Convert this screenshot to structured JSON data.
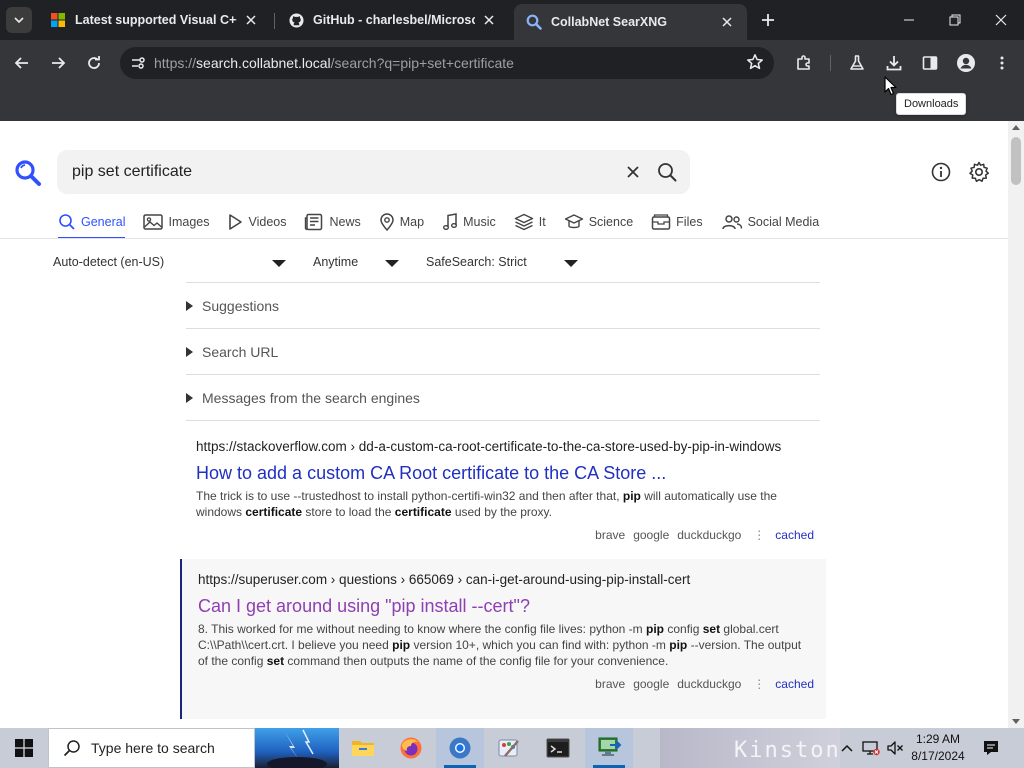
{
  "browser": {
    "tabs": [
      {
        "title": "Latest supported Visual C++ R",
        "favicon": "microsoft-logo",
        "active": false
      },
      {
        "title": "GitHub - charlesbel/Microsoft",
        "favicon": "github-icon",
        "active": false
      },
      {
        "title": "CollabNet SearXNG",
        "favicon": "search-icon",
        "active": true
      }
    ],
    "url_prefix": "https://",
    "url_host": "search.collabnet.local",
    "url_rest": "/search?q=pip+set+certificate",
    "tooltip": "Downloads"
  },
  "search": {
    "query": "pip set certificate",
    "categories": [
      {
        "label": "General",
        "icon": "search-icon",
        "active": true
      },
      {
        "label": "Images",
        "icon": "image-icon"
      },
      {
        "label": "Videos",
        "icon": "play-icon"
      },
      {
        "label": "News",
        "icon": "newspaper-icon"
      },
      {
        "label": "Map",
        "icon": "map-pin-icon"
      },
      {
        "label": "Music",
        "icon": "music-icon"
      },
      {
        "label": "It",
        "icon": "layers-icon"
      },
      {
        "label": "Science",
        "icon": "science-icon"
      },
      {
        "label": "Files",
        "icon": "files-icon"
      },
      {
        "label": "Social Media",
        "icon": "people-icon"
      }
    ],
    "filters": {
      "language": "Auto-detect (en-US)",
      "time": "Anytime",
      "safesearch": "SafeSearch: Strict"
    },
    "panels": [
      "Suggestions",
      "Search URL",
      "Messages from the search engines"
    ],
    "results": [
      {
        "url": "https://stackoverflow.com › dd-a-custom-ca-root-certificate-to-the-ca-store-used-by-pip-in-windows",
        "title": "How to add a custom CA Root certificate to the CA Store ...",
        "description_html": "The trick is to use --trustedhost to install python-certifi-win32 and then after that, <b>pip</b> will automatically use the windows <b>certificate</b> store to load the <b>certificate</b> used by the proxy.",
        "engines": [
          "brave",
          "google",
          "duckduckgo"
        ],
        "cached": "cached",
        "visited": false
      },
      {
        "url": "https://superuser.com › questions › 665069 › can-i-get-around-using-pip-install-cert",
        "title": "Can I get around using \"pip install --cert\"?",
        "description_html": "8. This worked for me without needing to know where the config file lives: python -m <b>pip</b> config <b>set</b> global.cert C:\\\\Path\\\\cert.crt. I believe you need <b>pip</b> version 10+, which you can find with: python -m <b>pip</b> --version. The output of the config <b>set</b> command then outputs the name of the config file for your convenience.",
        "engines": [
          "brave",
          "google",
          "duckduckgo"
        ],
        "cached": "cached",
        "visited": true
      }
    ]
  },
  "taskbar": {
    "search_placeholder": "Type here to search",
    "time": "1:29 AM",
    "date": "8/17/2024",
    "wallpaper_text": "Kinston"
  },
  "colors": {
    "accent": "#3050ff",
    "link": "#2030c0",
    "visited": "#8f3fb3"
  }
}
